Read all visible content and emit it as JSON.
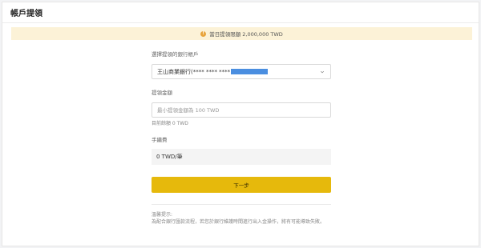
{
  "page": {
    "title": "帳戶提領"
  },
  "notice": {
    "icon": "info-icon",
    "text": "當日提領限額 2,000,000 TWD"
  },
  "form": {
    "account_label": "選擇提領的銀行帳戶",
    "account_value": "王山商業銀行(**** **** ****",
    "amount_label": "提領金額",
    "amount_placeholder": "最小提領金額為 100 TWD",
    "balance_text": "目前餘額  0 TWD",
    "fee_label": "手續費",
    "fee_value": "0 TWD/筆",
    "next_button": "下一步"
  },
  "tips": {
    "title": "溫馨提示:",
    "body": "為配合銀行匯款流程，若您於銀行維護時間進行出入金操作，將有可能導致失敗。"
  },
  "colors": {
    "accent": "#e6b90c",
    "notice_bg": "#fcf2d7",
    "redaction": "#4a8ee0"
  }
}
